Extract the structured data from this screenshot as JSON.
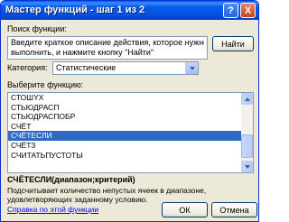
{
  "window": {
    "title": "Мастер функций - шаг 1 из 2",
    "help_button": "?",
    "close_button": "X"
  },
  "search": {
    "label": "Поиск функции:",
    "placeholder_line1": "Введите краткое описание действия, которое нужно",
    "placeholder_line2": "выполнить, и нажмите кнопку \"Найти\"",
    "find_button": "Найти"
  },
  "category": {
    "label": "Категория:",
    "value": "Статистические"
  },
  "functions": {
    "label": "Выберите функцию:",
    "items": [
      "СТОШYX",
      "СТЬЮДРАСП",
      "СТЬЮДРАСПОБР",
      "СЧЁТ",
      "СЧЁТЕСЛИ",
      "СЧЁТЗ",
      "СЧИТАТЬПУСТОТЫ"
    ],
    "selected_index": 4
  },
  "selected_function": {
    "signature": "СЧЁТЕСЛИ(диапазон;критерий)",
    "description_line1": "Подсчитывает количество непустых ячеек в диапазоне,",
    "description_line2": "удовлетворяющих заданному условию."
  },
  "footer": {
    "help_link": "Справка по этой функции",
    "ok_button": "ОК",
    "cancel_button": "Отмена"
  },
  "colors": {
    "titlebar": "#0453e1",
    "selection": "#316ac5",
    "link": "#0000ff"
  }
}
